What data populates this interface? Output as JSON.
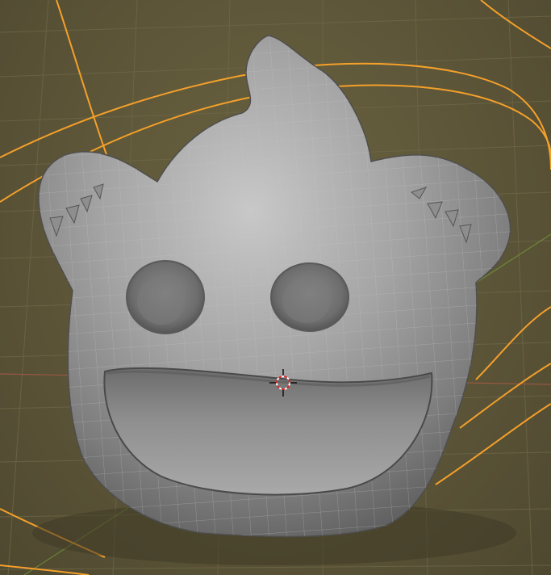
{
  "viewport": {
    "mode": "3d-viewport",
    "object": "ghost-mesh",
    "shading": "solid-wireframe"
  },
  "colors": {
    "background": "#5c5538",
    "grid": "#6b6444",
    "mesh": "#9d9d9d",
    "mesh_shadow": "#4a4a4a",
    "wire": "#b9b9b9",
    "selection_outline": "#f5a02a",
    "axis_x": "#c0504d",
    "axis_y": "#7aa83a",
    "cursor_red": "#d12c2c"
  },
  "icons": {
    "cursor": "3d-cursor-icon"
  }
}
